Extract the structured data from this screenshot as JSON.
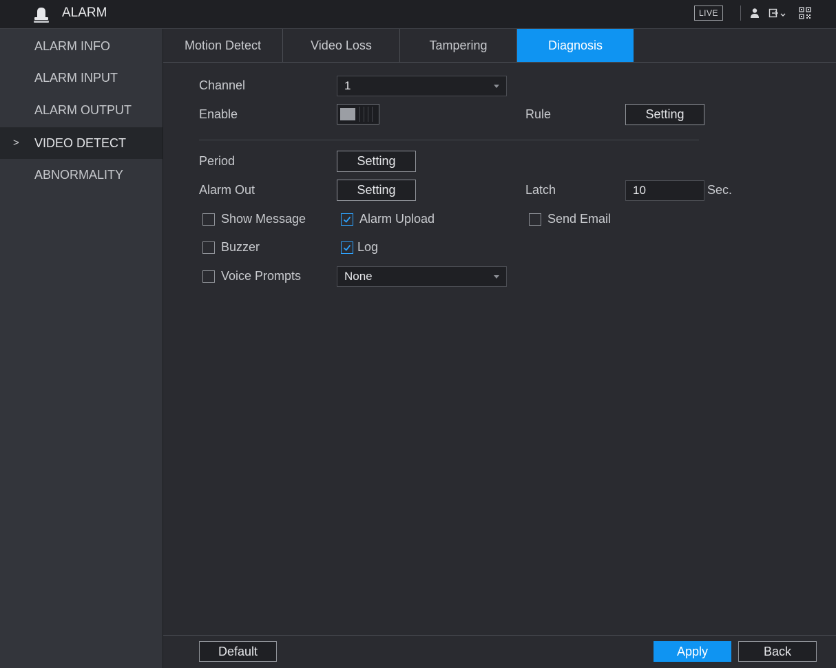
{
  "app": {
    "title": "ALARM",
    "live_label": "LIVE"
  },
  "icons": {
    "app_logo": "alarm-bell-icon",
    "user": "user-icon",
    "logout": "logout-icon",
    "qr": "qr-code-icon",
    "checkmark": "check-icon"
  },
  "colors": {
    "accent": "#0f94f2",
    "background": "#2a2b30",
    "sidebar": "#33353b",
    "checkbox_check": "#2ea3ff"
  },
  "sidebar": {
    "items": [
      {
        "label": "ALARM INFO",
        "active": false
      },
      {
        "label": "ALARM INPUT",
        "active": false
      },
      {
        "label": "ALARM OUTPUT",
        "active": false
      },
      {
        "label": "VIDEO DETECT",
        "active": true
      },
      {
        "label": "ABNORMALITY",
        "active": false
      }
    ],
    "active_marker": ">"
  },
  "tabs": [
    {
      "label": "Motion Detect",
      "active": false
    },
    {
      "label": "Video Loss",
      "active": false
    },
    {
      "label": "Tampering",
      "active": false
    },
    {
      "label": "Diagnosis",
      "active": true
    }
  ],
  "form": {
    "channel": {
      "label": "Channel",
      "value": "1"
    },
    "enable": {
      "label": "Enable",
      "state": "off"
    },
    "rule": {
      "label": "Rule",
      "button": "Setting"
    },
    "period": {
      "label": "Period",
      "button": "Setting"
    },
    "alarm_out": {
      "label": "Alarm Out",
      "button": "Setting"
    },
    "latch": {
      "label": "Latch",
      "value": "10",
      "unit": "Sec."
    },
    "checkboxes": {
      "show_message": {
        "label": "Show Message",
        "checked": false
      },
      "alarm_upload": {
        "label": "Alarm Upload",
        "checked": true
      },
      "send_email": {
        "label": "Send Email",
        "checked": false
      },
      "buzzer": {
        "label": "Buzzer",
        "checked": false
      },
      "log": {
        "label": "Log",
        "checked": true
      },
      "voice_prompts": {
        "label": "Voice Prompts",
        "checked": false
      }
    },
    "voice_prompts_select": {
      "value": "None"
    }
  },
  "footer": {
    "default_label": "Default",
    "apply_label": "Apply",
    "back_label": "Back"
  }
}
